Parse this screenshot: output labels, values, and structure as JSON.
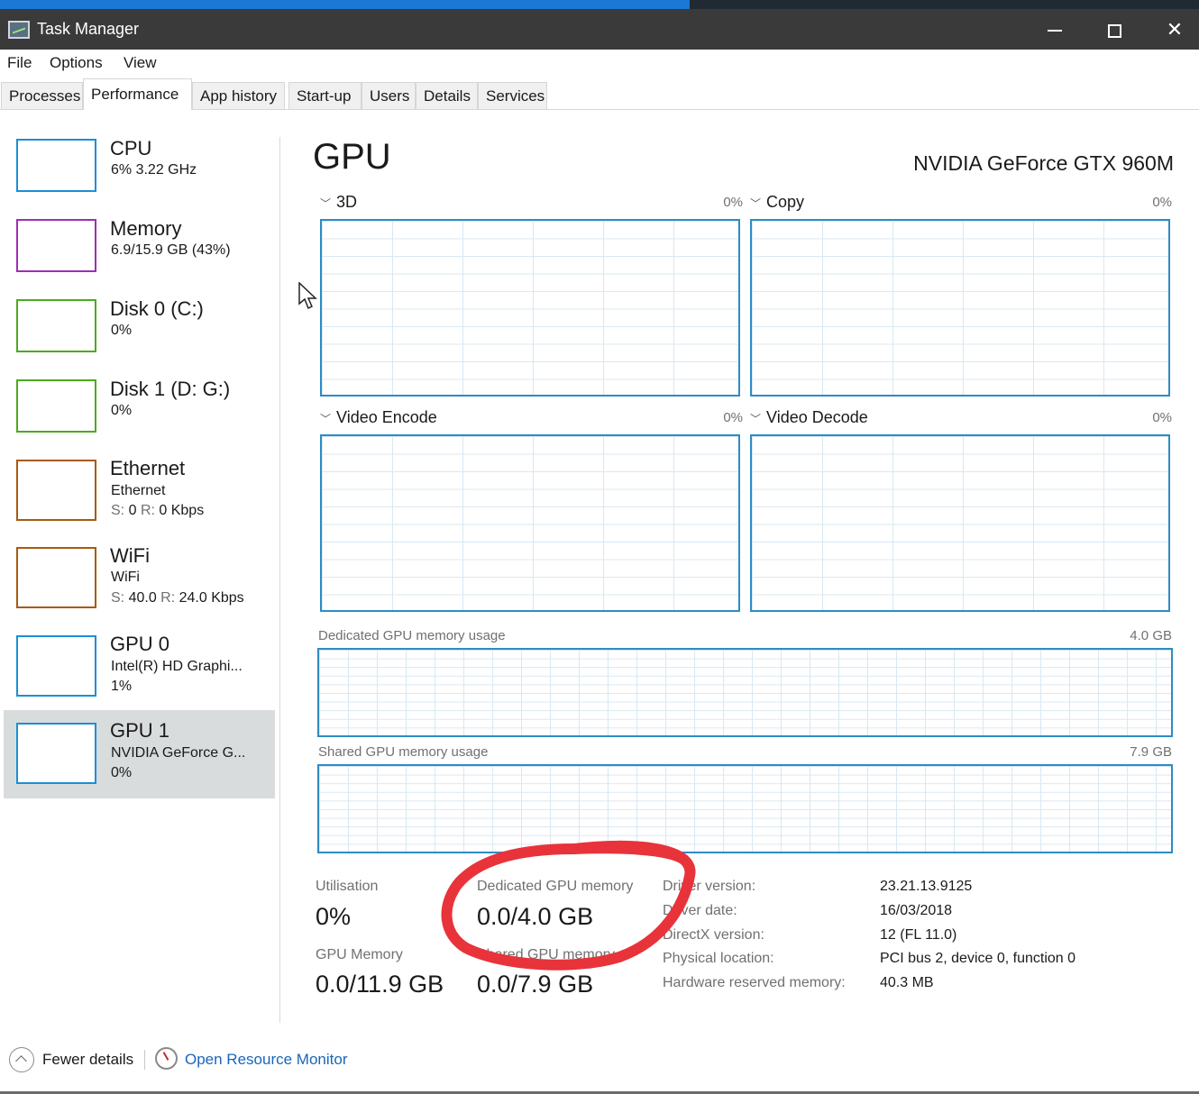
{
  "window": {
    "title": "Task Manager"
  },
  "menu": [
    "File",
    "Options",
    "View"
  ],
  "tabs": [
    "Processes",
    "Performance",
    "App history",
    "Start-up",
    "Users",
    "Details",
    "Services"
  ],
  "sidebar": [
    {
      "name": "CPU",
      "sub1": "6% 3.22 GHz",
      "color": "#1a8fd6"
    },
    {
      "name": "Memory",
      "sub1": "6.9/15.9 GB (43%)",
      "color": "#9d2fb5"
    },
    {
      "name": "Disk 0 (C:)",
      "sub1": "0%",
      "color": "#4caa1f"
    },
    {
      "name": "Disk 1 (D: G:)",
      "sub1": "0%",
      "color": "#4caa1f"
    },
    {
      "name": "Ethernet",
      "sub1": "Ethernet",
      "s_label": "S:",
      "s_val": "0",
      "r_label": "R:",
      "r_val": "0 Kbps",
      "color": "#a85a10"
    },
    {
      "name": "WiFi",
      "sub1": "WiFi",
      "s_label": "S:",
      "s_val": "40.0",
      "r_label": "R:",
      "r_val": "24.0 Kbps",
      "color": "#a85a10"
    },
    {
      "name": "GPU 0",
      "sub1": "Intel(R) HD Graphi...",
      "sub2": "1%",
      "color": "#1a8fd6"
    },
    {
      "name": "GPU 1",
      "sub1": "NVIDIA GeForce G...",
      "sub2": "0%",
      "color": "#1a8fd6"
    }
  ],
  "main": {
    "title": "GPU",
    "gpu_name": "NVIDIA GeForce GTX 960M",
    "engines": [
      {
        "name": "3D",
        "pct": "0%"
      },
      {
        "name": "Copy",
        "pct": "0%"
      },
      {
        "name": "Video Encode",
        "pct": "0%"
      },
      {
        "name": "Video Decode",
        "pct": "0%"
      }
    ],
    "dedicated_graph": {
      "label": "Dedicated GPU memory usage",
      "max": "4.0 GB"
    },
    "shared_graph": {
      "label": "Shared GPU memory usage",
      "max": "7.9 GB"
    },
    "stats": {
      "utilisation_label": "Utilisation",
      "utilisation": "0%",
      "dedicated_label": "Dedicated GPU memory",
      "dedicated": "0.0/4.0 GB",
      "gpu_memory_label": "GPU Memory",
      "gpu_memory": "0.0/11.9 GB",
      "shared_label": "Shared GPU memory",
      "shared": "0.0/7.9 GB"
    },
    "info": [
      {
        "key": "Driver version:",
        "value": "23.21.13.9125"
      },
      {
        "key": "Driver date:",
        "value": "16/03/2018"
      },
      {
        "key": "DirectX version:",
        "value": "12 (FL 11.0)"
      },
      {
        "key": "Physical location:",
        "value": "PCI bus 2, device 0, function 0"
      },
      {
        "key": "Hardware reserved memory:",
        "value": "40.3 MB"
      }
    ]
  },
  "footer": {
    "fewer_details": "Fewer details",
    "open_monitor": "Open Resource Monitor"
  },
  "annotation_color": "#e8333a",
  "accent_color": "#2d8cc4"
}
